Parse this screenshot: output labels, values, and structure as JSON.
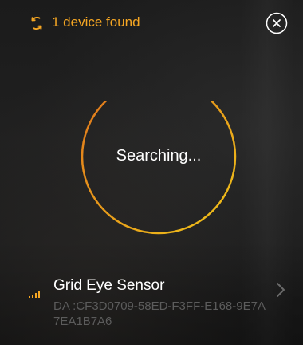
{
  "header": {
    "status_icon": "refresh-icon",
    "status_text": "1 device found",
    "close_icon": "close-icon"
  },
  "search": {
    "label": "Searching...",
    "ring_colors": [
      "#e0741c",
      "#f0c419"
    ]
  },
  "devices": [
    {
      "signal_icon": "signal-strength-icon",
      "name": "Grid Eye Sensor",
      "address": "DA :CF3D0709-58ED-F3FF-E168-9E7A7EA1B7A6",
      "chevron_icon": "chevron-right-icon"
    }
  ],
  "colors": {
    "accent": "#f5a623",
    "text": "#ffffff",
    "muted": "#5c5c5c"
  }
}
